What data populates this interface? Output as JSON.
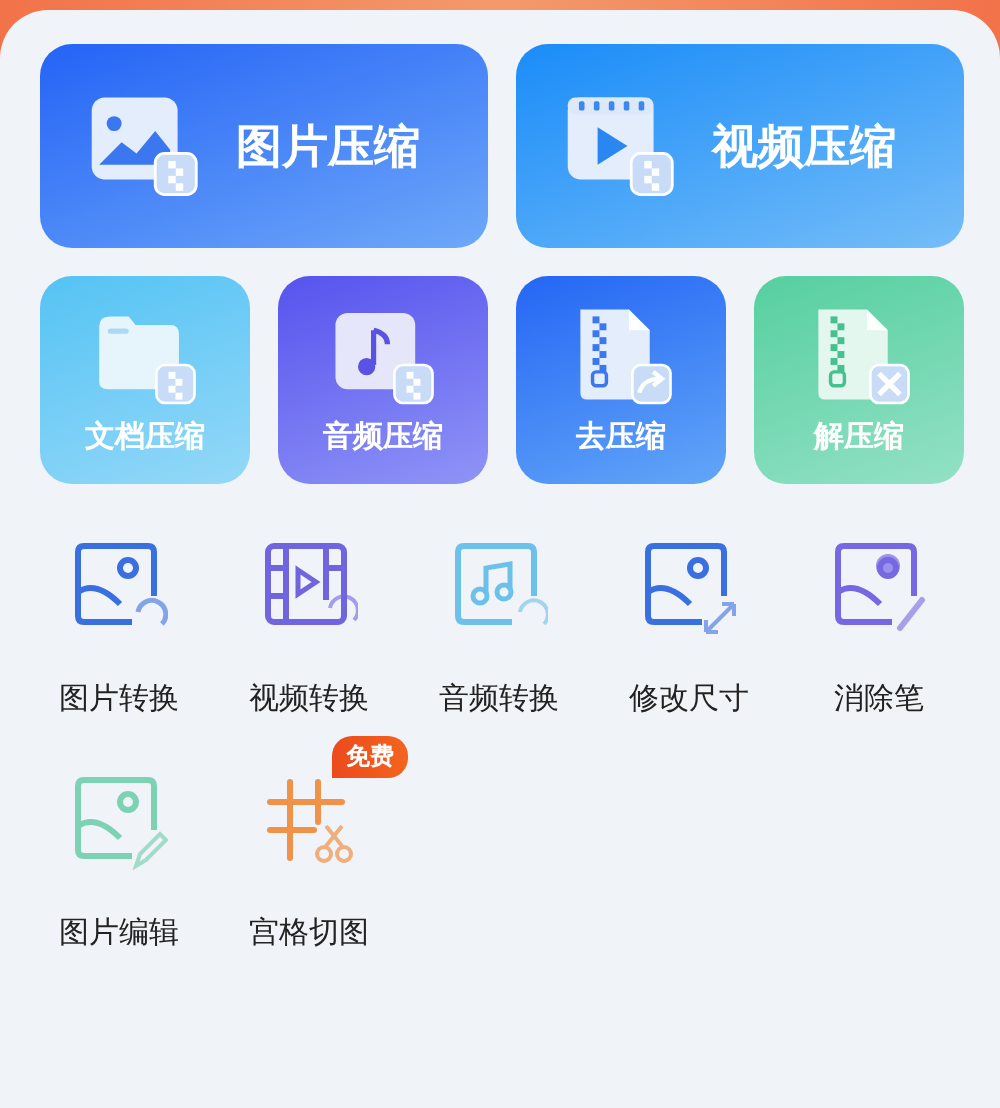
{
  "large_tiles": [
    {
      "label": "图片压缩",
      "kind": "image"
    },
    {
      "label": "视频压缩",
      "kind": "video"
    }
  ],
  "small_tiles": [
    {
      "label": "文档压缩",
      "kind": "document"
    },
    {
      "label": "音频压缩",
      "kind": "audio"
    },
    {
      "label": "去压缩",
      "kind": "zip"
    },
    {
      "label": "解压缩",
      "kind": "unzip"
    }
  ],
  "tools": [
    {
      "label": "图片转换",
      "kind": "image-convert"
    },
    {
      "label": "视频转换",
      "kind": "video-convert"
    },
    {
      "label": "音频转换",
      "kind": "audio-convert"
    },
    {
      "label": "修改尺寸",
      "kind": "resize"
    },
    {
      "label": "消除笔",
      "kind": "eraser"
    },
    {
      "label": "图片编辑",
      "kind": "image-edit"
    },
    {
      "label": "宫格切图",
      "kind": "grid-cut",
      "badge": "免费"
    }
  ]
}
